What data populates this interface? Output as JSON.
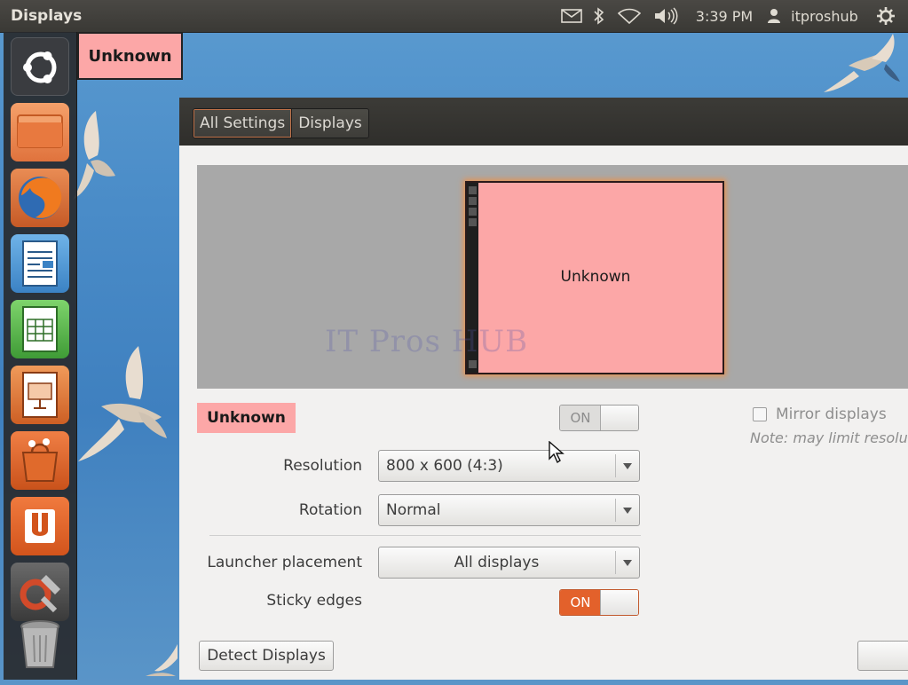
{
  "top_panel": {
    "app_title": "Displays",
    "clock": "3:39 PM",
    "username": "itproshub",
    "tray_icons": [
      "mail-icon",
      "bluetooth-icon",
      "wifi-icon",
      "volume-icon",
      "user-icon",
      "gear-icon"
    ]
  },
  "launcher": {
    "items": [
      "ubuntu-dash-icon",
      "files-icon",
      "firefox-icon",
      "writer-icon",
      "calc-icon",
      "impress-icon",
      "software-center-icon",
      "ubuntu-one-icon",
      "system-settings-icon",
      "trash-icon"
    ]
  },
  "display_tag": "Unknown",
  "window": {
    "breadcrumbs": [
      "All Settings",
      "Displays"
    ],
    "preview": {
      "monitor_label": "Unknown",
      "watermark": "IT Pros HUB"
    },
    "display_name": "Unknown",
    "display_switch": "ON",
    "mirror": {
      "label": "Mirror displays",
      "note": "Note: may limit resolu"
    },
    "resolution": {
      "label": "Resolution",
      "value": "800 x 600 (4:3)"
    },
    "rotation": {
      "label": "Rotation",
      "value": "Normal"
    },
    "launcher_placement": {
      "label": "Launcher placement",
      "value": "All displays"
    },
    "sticky_edges": {
      "label": "Sticky edges",
      "state": "ON"
    },
    "detect_button": "Detect Displays"
  },
  "colors": {
    "display_color": "#fca7a7",
    "accent_orange": "#e3612b",
    "panel_dark": "#3c3b37"
  }
}
